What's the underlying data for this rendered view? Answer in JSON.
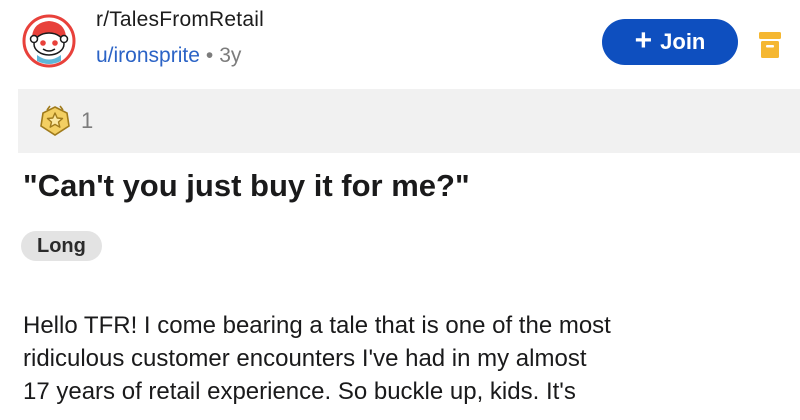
{
  "header": {
    "subreddit": "r/TalesFromRetail",
    "username": "u/ironsprite",
    "separator": "•",
    "age": "3y",
    "join_icon": "plus-icon",
    "join_plus": "+",
    "join_label": "Join",
    "avatar_icon": "reddit-snoo-avatar",
    "save_icon": "bookmark-icon"
  },
  "awards": {
    "icon": "award-badge-icon",
    "count": "1"
  },
  "post": {
    "title": "\"Can't you just buy it for me?\"",
    "flair": "Long",
    "body_lines": [
      "Hello TFR! I come bearing a tale that is one of the most",
      "ridiculous customer encounters I've had in my almost",
      "17 years of retail experience.  So buckle up, kids.  It's"
    ]
  },
  "colors": {
    "join_button": "#0e4fbf",
    "username": "#2b63c6",
    "awards_bar": "#f1f1f1",
    "flair_bg": "#e3e3e3",
    "save_icon": "#f5b731",
    "avatar_ring": "#e8413b"
  }
}
